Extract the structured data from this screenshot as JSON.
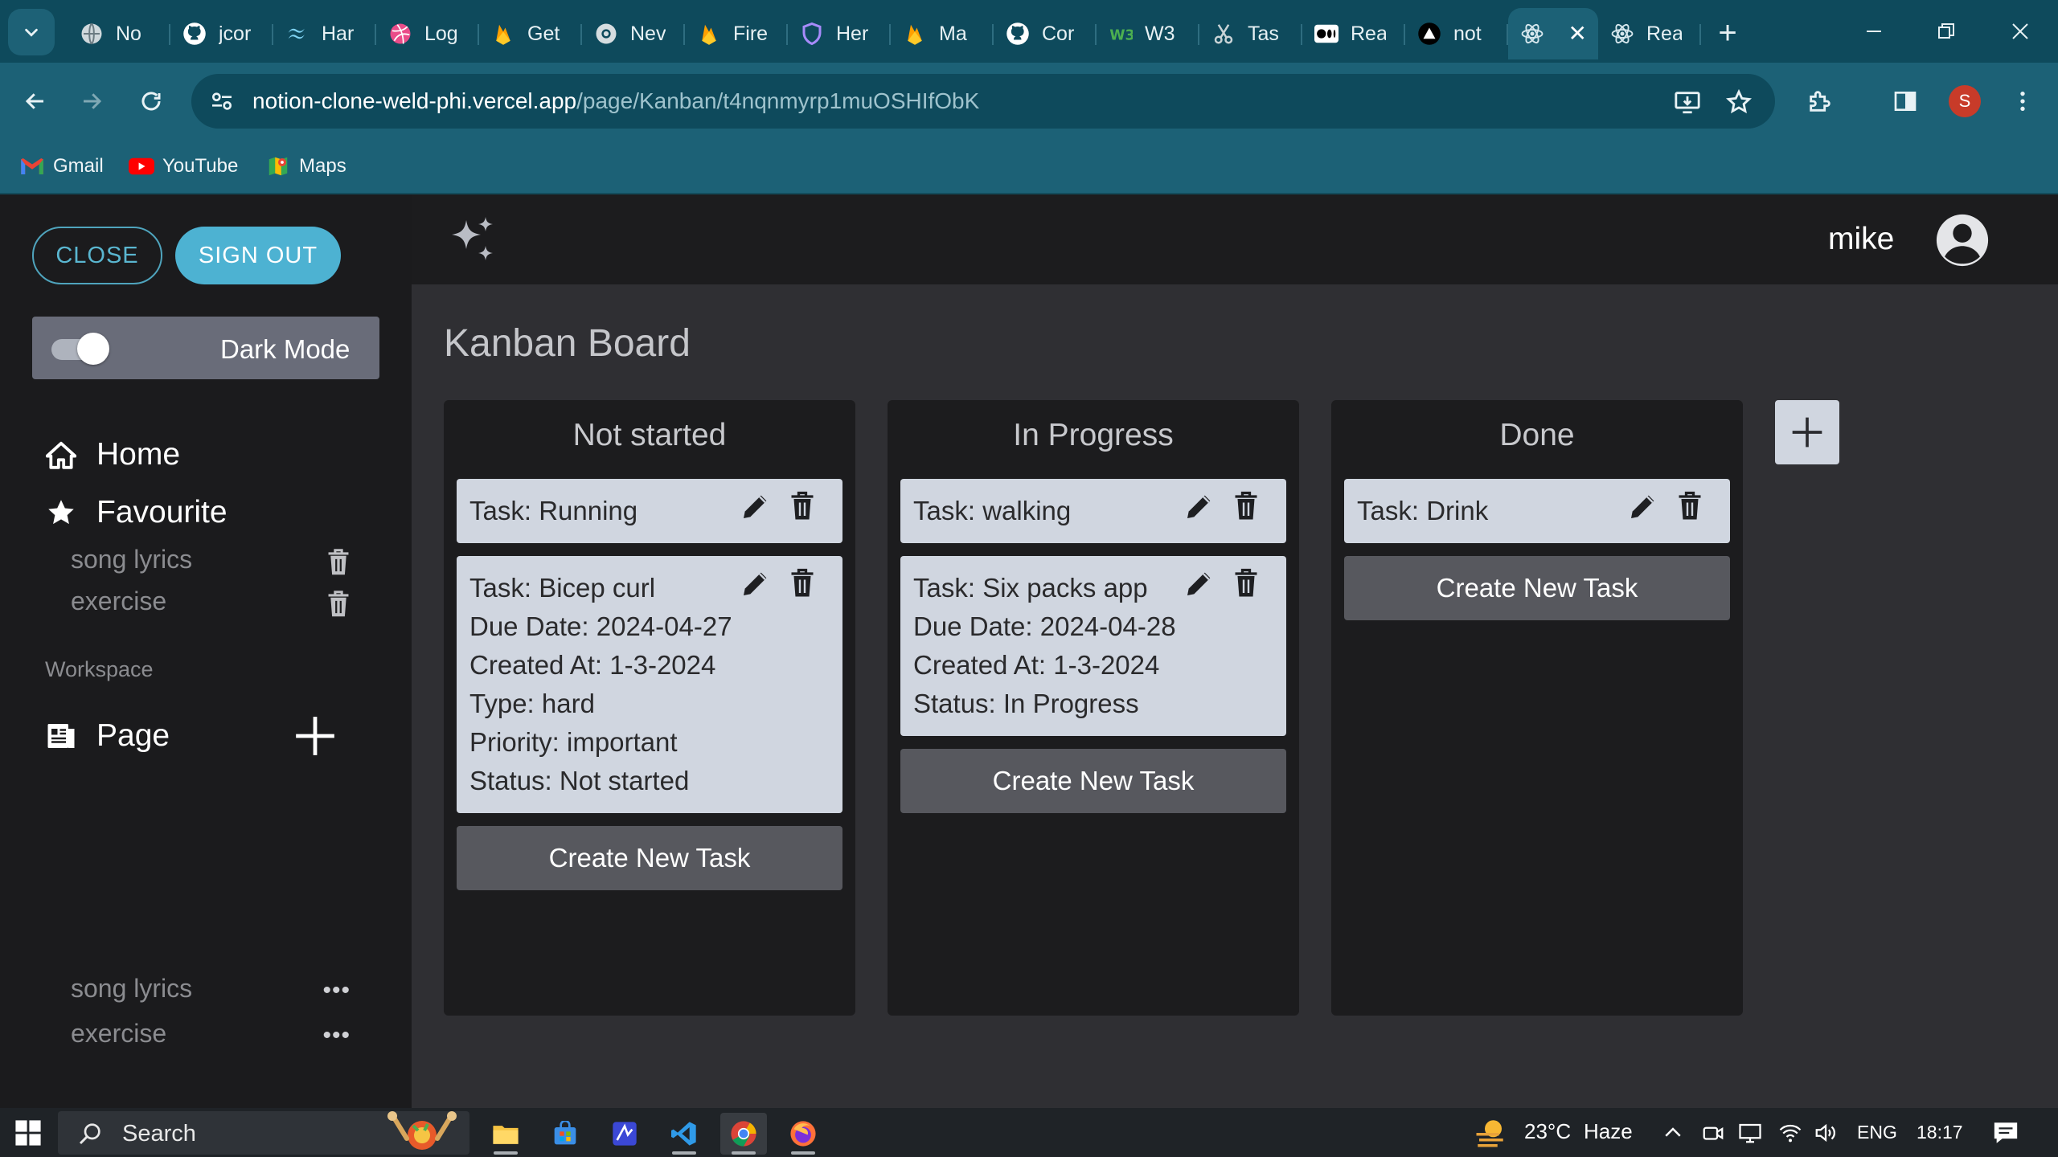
{
  "browser": {
    "tabs": [
      {
        "label": "No",
        "icon": "globe-icon"
      },
      {
        "label": "jcor",
        "icon": "github-icon"
      },
      {
        "label": "Har",
        "icon": "tailwind-icon"
      },
      {
        "label": "Log",
        "icon": "dribbble-icon"
      },
      {
        "label": "Get",
        "icon": "firebase-icon"
      },
      {
        "label": "Nev",
        "icon": "chrome-icon"
      },
      {
        "label": "Fire",
        "icon": "firebase-icon"
      },
      {
        "label": "Her",
        "icon": "shield-icon"
      },
      {
        "label": "Ma",
        "icon": "firebase-icon"
      },
      {
        "label": "Cor",
        "icon": "github-icon"
      },
      {
        "label": "W3",
        "icon": "w3schools-icon"
      },
      {
        "label": "Tas",
        "icon": "scissors-icon"
      },
      {
        "label": "Rea",
        "icon": "medium-icon"
      },
      {
        "label": "not",
        "icon": "vercel-icon"
      },
      {
        "label": "",
        "icon": "react-icon",
        "active": true
      },
      {
        "label": "Rea",
        "icon": "react-icon"
      }
    ],
    "url_host": "notion-clone-weld-phi.vercel.app",
    "url_path": "/page/Kanban/t4nqnmyrp1muOSHIfObK",
    "profile_initial": "S",
    "bookmarks": [
      {
        "label": "Gmail",
        "icon": "gmail-icon"
      },
      {
        "label": "YouTube",
        "icon": "youtube-icon"
      },
      {
        "label": "Maps",
        "icon": "maps-icon"
      }
    ]
  },
  "sidebar": {
    "close_label": "CLOSE",
    "signout_label": "SIGN OUT",
    "dark_mode_label": "Dark Mode",
    "home_label": "Home",
    "favourite_label": "Favourite",
    "favourites": [
      "song lyrics",
      "exercise"
    ],
    "workspace_label": "Workspace",
    "page_label": "Page",
    "pages": [
      "song lyrics",
      "exercise"
    ]
  },
  "header": {
    "username": "mike"
  },
  "board": {
    "title": "Kanban Board",
    "create_task_label": "Create New Task",
    "columns": [
      {
        "title": "Not started",
        "cards": [
          {
            "lines": [
              "Task: Running"
            ]
          },
          {
            "lines": [
              "Task: Bicep curl",
              "Due Date: 2024-04-27",
              "Created At: 1-3-2024",
              "Type: hard",
              "Priority: important",
              "Status: Not started"
            ]
          }
        ]
      },
      {
        "title": "In Progress",
        "cards": [
          {
            "lines": [
              "Task: walking"
            ]
          },
          {
            "lines": [
              "Task: Six packs app",
              "Due Date: 2024-04-28",
              "Created At: 1-3-2024",
              "Status: In Progress"
            ]
          }
        ]
      },
      {
        "title": "Done",
        "cards": [
          {
            "lines": [
              "Task: Drink"
            ]
          }
        ]
      }
    ]
  },
  "taskbar": {
    "search_label": "Search",
    "weather_temp": "23°C",
    "weather_text": "Haze",
    "language": "ENG",
    "time": "18:17"
  }
}
